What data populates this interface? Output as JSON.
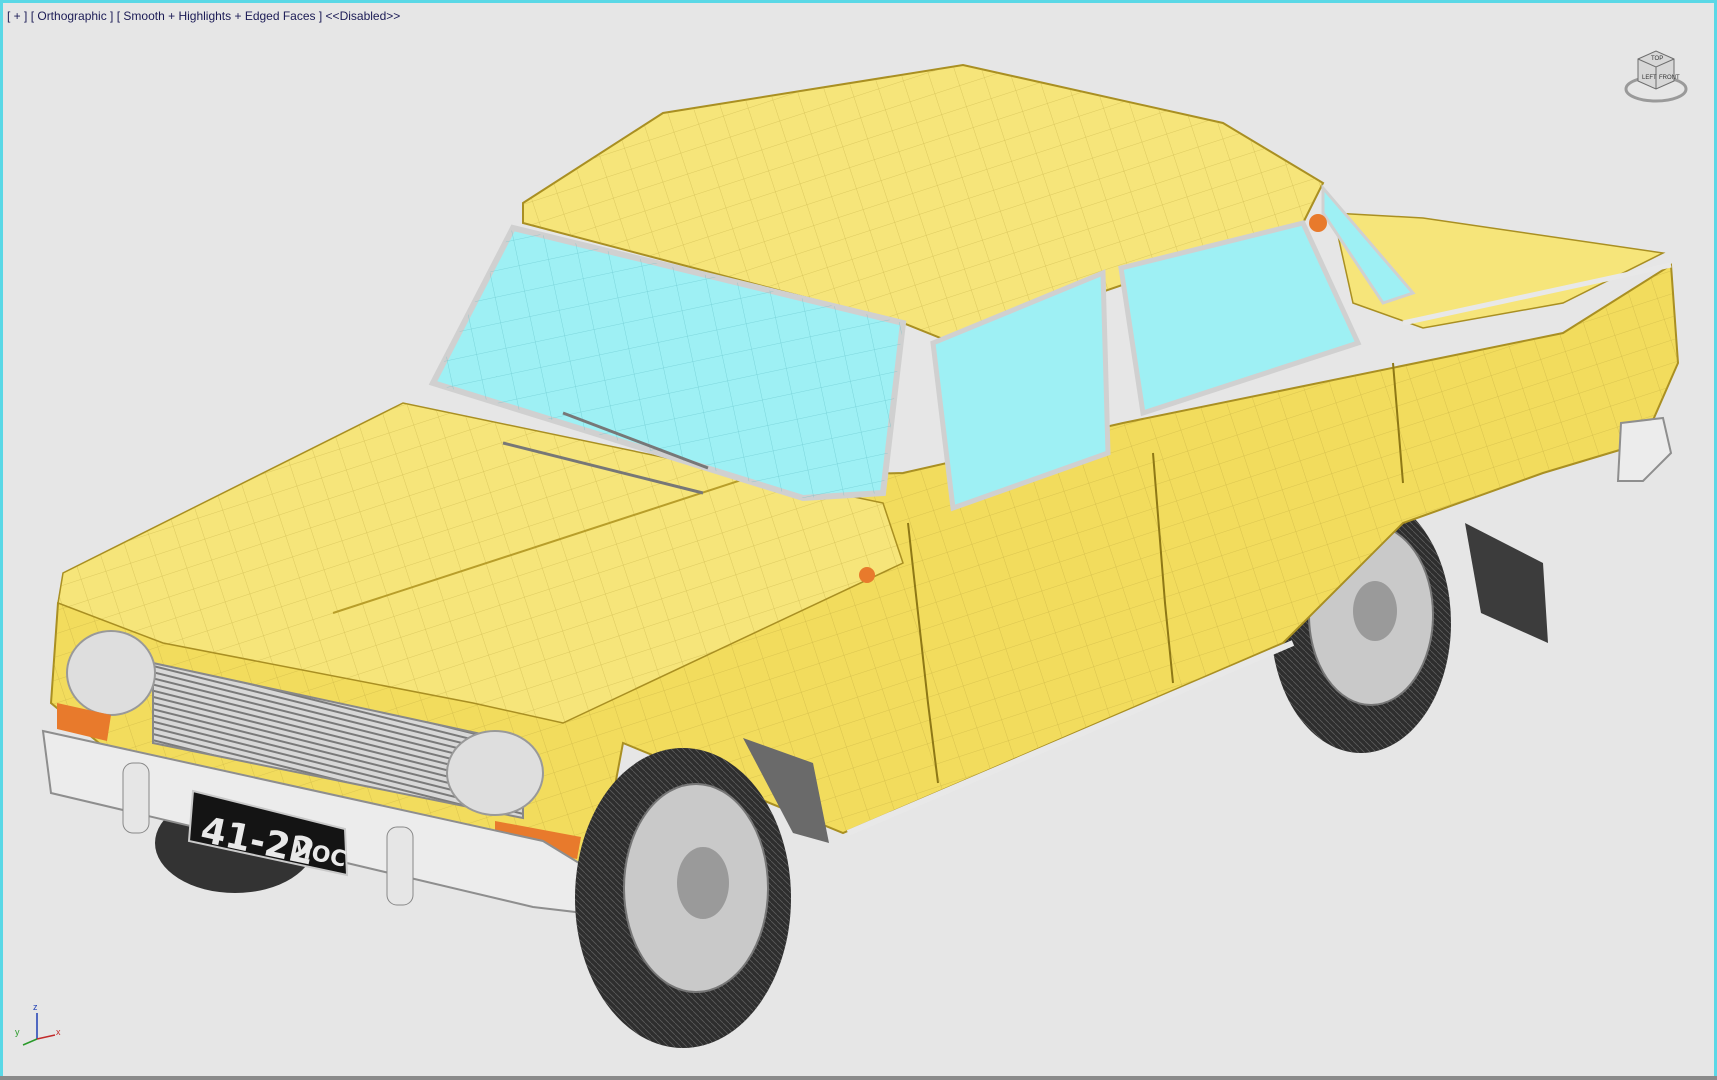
{
  "viewport": {
    "labels": {
      "plus": "[ + ]",
      "view": "[ Orthographic ]",
      "shading": "[ Smooth + Highlights + Edged Faces ]",
      "status": "<<Disabled>>"
    },
    "active_border_color": "#5ad8e6",
    "background_color": "#e6e6e6"
  },
  "viewcube": {
    "faces": {
      "left": "LEFT",
      "front": "FRONT",
      "top": "TOP"
    }
  },
  "axis_tripod": {
    "x": "x",
    "y": "y",
    "z": "z"
  },
  "model": {
    "body_color": "#f2dc5d",
    "glass_color": "#9ef0f4",
    "chrome_color": "#e8e8e8",
    "tire_color": "#3a3a3a",
    "license_plate": {
      "number": "41-22",
      "region": "МОС"
    }
  }
}
